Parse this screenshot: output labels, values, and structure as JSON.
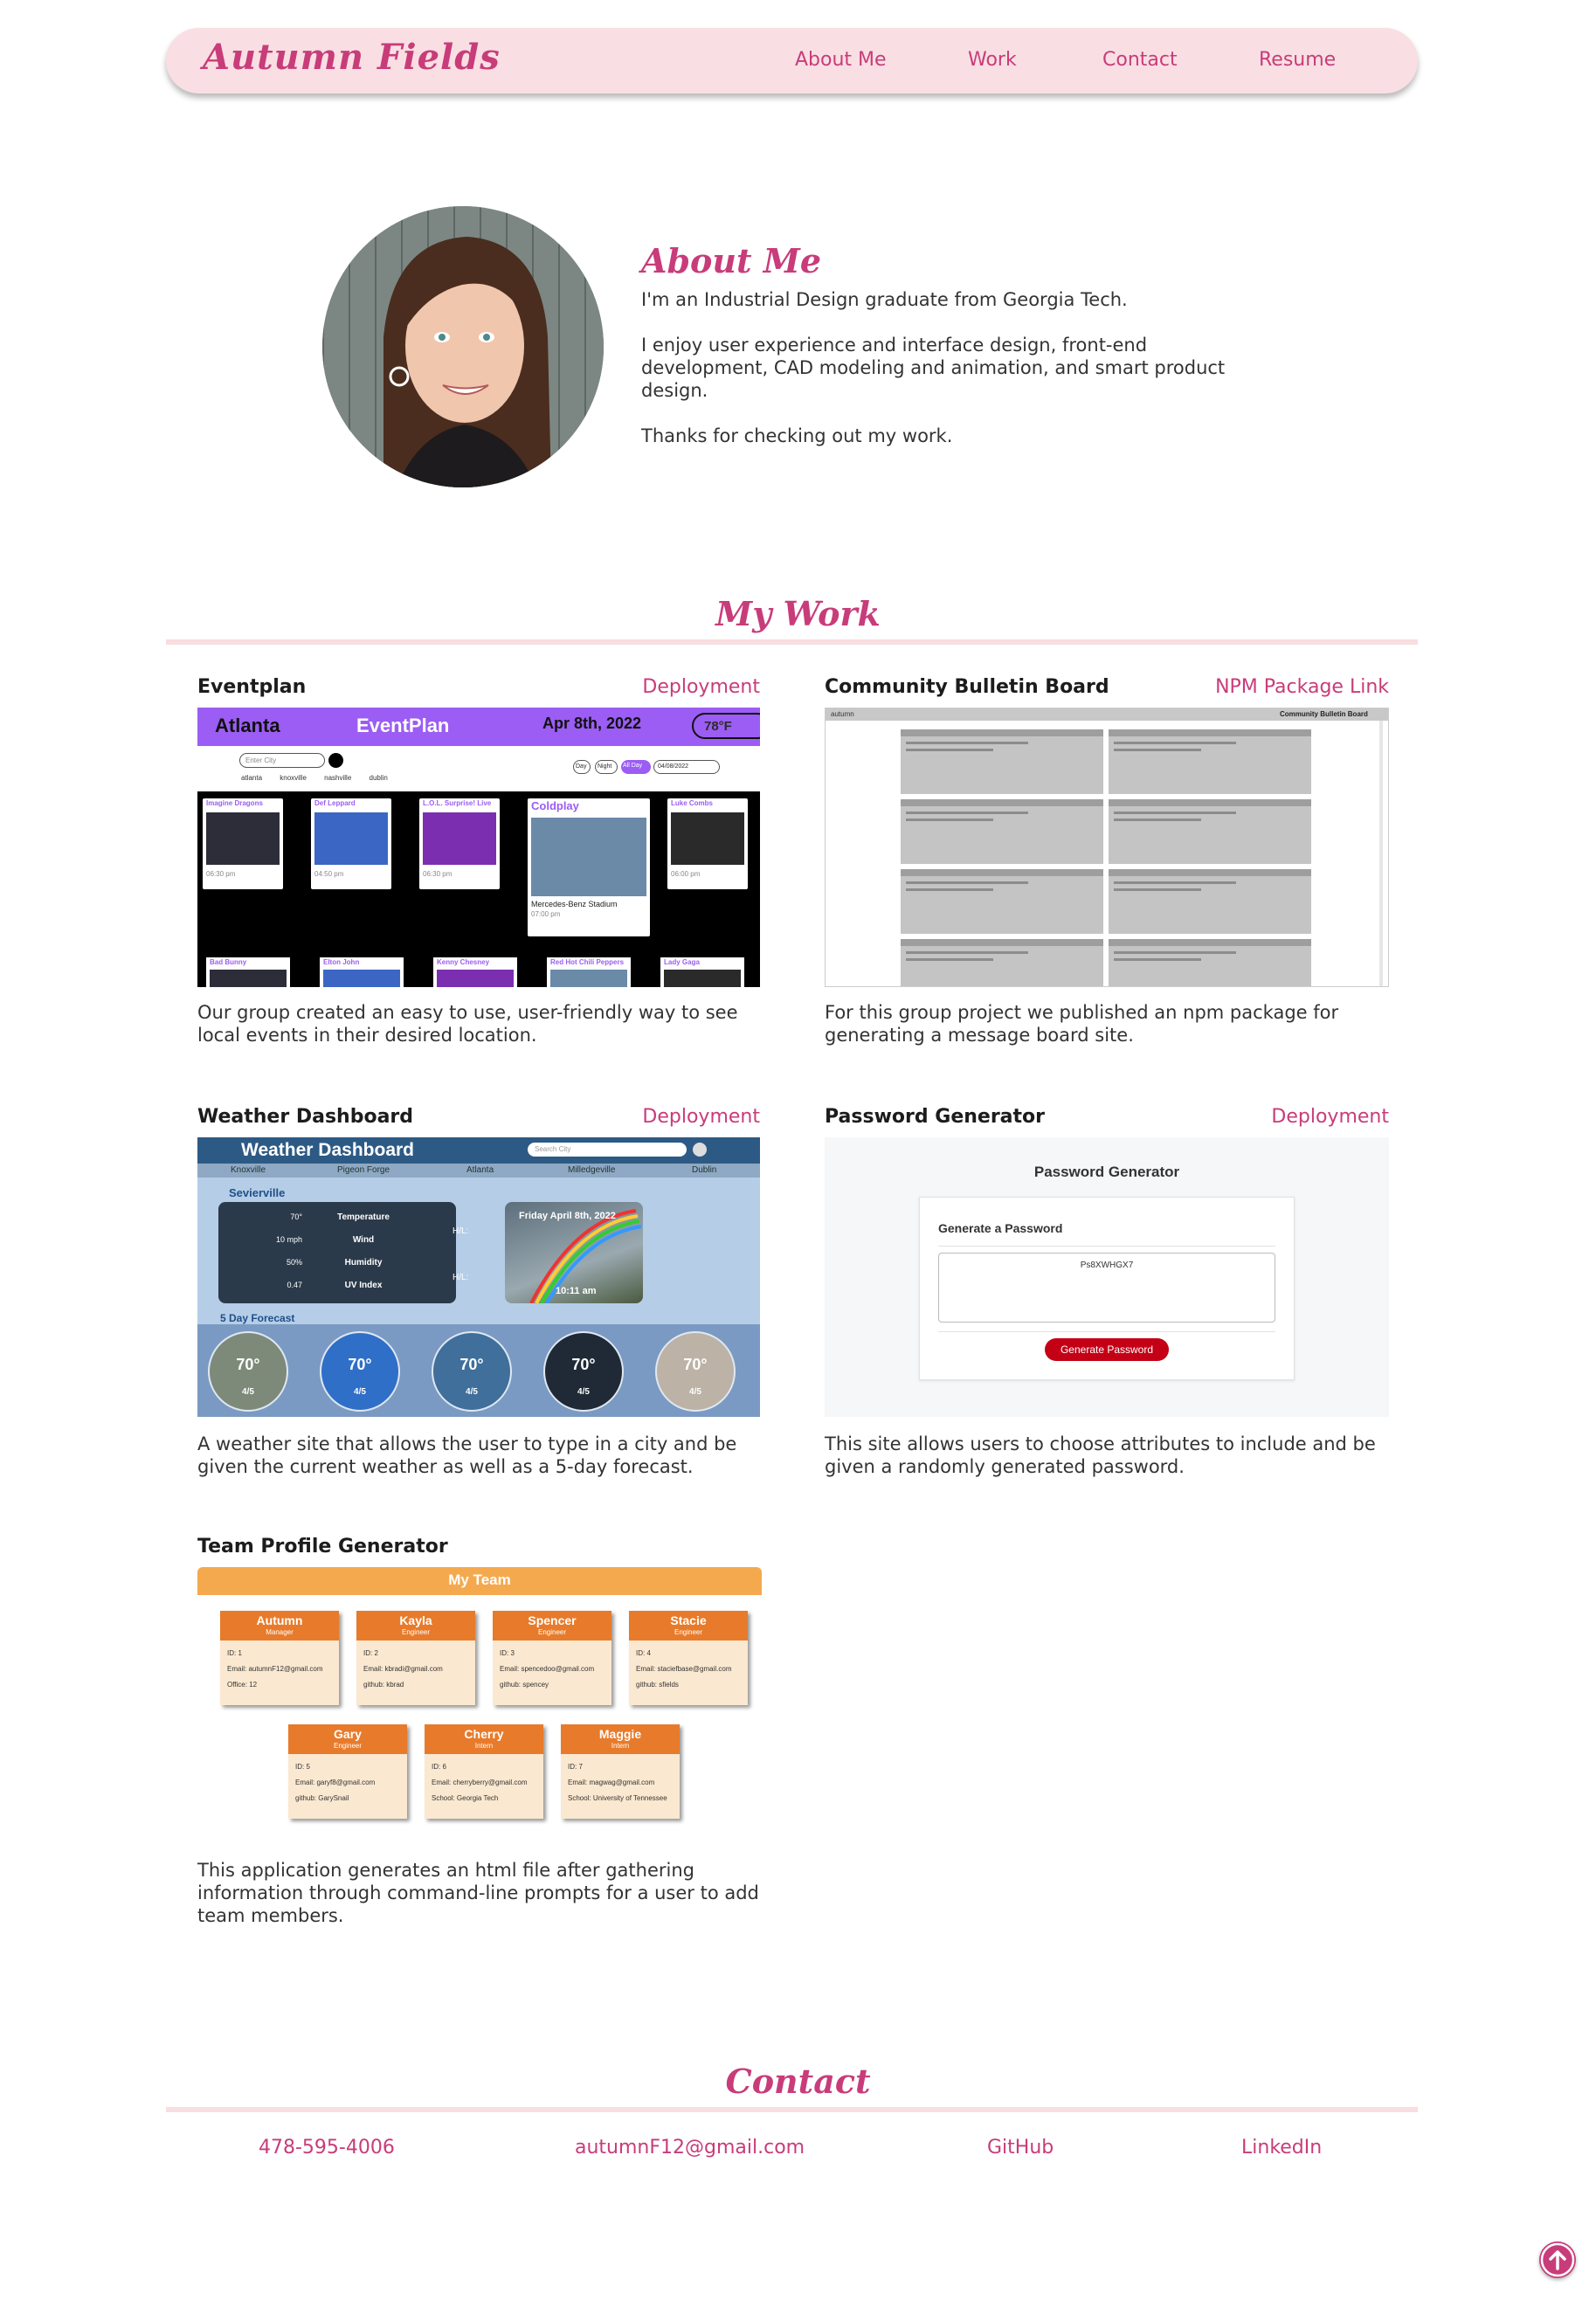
{
  "header": {
    "logo": "Autumn Fields",
    "nav": [
      "About Me",
      "Work",
      "Contact",
      "Resume"
    ]
  },
  "about": {
    "title": "About Me",
    "paragraphs": [
      "I'm an Industrial Design graduate from Georgia Tech.",
      "I enjoy user experience and interface design, front-end development, CAD modeling and animation, and smart product design.",
      "Thanks for checking out my work."
    ]
  },
  "work": {
    "title": "My Work",
    "projects": [
      {
        "title": "Eventplan",
        "link": "Deployment",
        "description": "Our group created an easy to use, user-friendly way to see local events in their desired location."
      },
      {
        "title": "Community Bulletin Board",
        "link": "NPM Package Link",
        "description": "For this group project we published an npm package for generating a message board site."
      },
      {
        "title": "Weather Dashboard",
        "link": "Deployment",
        "description": "A weather site that allows the user to type in a city and be given the current weather as well as a 5-day forecast."
      },
      {
        "title": "Password Generator",
        "link": "Deployment",
        "description": "This site allows users to choose attributes to include and be given a randomly generated password."
      },
      {
        "title": "Team Profile Generator",
        "link": "",
        "description": "This application generates an html file after gathering information through command-line prompts for a user to add team members."
      }
    ]
  },
  "eventplan_shot": {
    "city": "Atlanta",
    "app": "EventPlan",
    "date": "Apr 8th, 2022",
    "temp": "78°F",
    "search_placeholder": "Enter City",
    "cities": [
      "atlanta",
      "knoxville",
      "nashville",
      "dublin"
    ],
    "filters": [
      "Day",
      "Night",
      "All Day"
    ],
    "date_input": "04/08/2022",
    "events": [
      {
        "name": "Imagine Dragons",
        "time": "06:30 pm"
      },
      {
        "name": "Def Leppard",
        "time": "04:50 pm"
      },
      {
        "name": "L.O.L. Surprise! Live",
        "time": "06:30 pm"
      },
      {
        "name": "Coldplay",
        "time": "07:00 pm",
        "venue": "Mercedes-Benz Stadium"
      },
      {
        "name": "Luke Combs",
        "time": "06:00 pm"
      }
    ],
    "events_row2": [
      "Bad Bunny",
      "Elton John",
      "Kenny Chesney",
      "Red Hot Chili Peppers",
      "Lady Gaga"
    ]
  },
  "bulletin_shot": {
    "left_label": "autumn",
    "right_label": "Community Bulletin Board"
  },
  "weather_shot": {
    "title": "Weather Dashboard",
    "search_placeholder": "Search City",
    "cities": [
      "Knoxville",
      "Pigeon Forge",
      "Atlanta",
      "Milledgeville",
      "Dublin"
    ],
    "current_city": "Sevierville",
    "stats": [
      {
        "value": "70°",
        "label": "Temperature"
      },
      {
        "value": "10 mph",
        "label": "Wind"
      },
      {
        "value": "50%",
        "label": "Humidity"
      },
      {
        "value": "0.47",
        "label": "UV Index"
      }
    ],
    "hl_label": "H/L:",
    "day_label": "Friday April 8th, 2022",
    "clock": "10:11 am",
    "forecast_title": "5 Day Forecast",
    "forecast": [
      {
        "temp": "70°",
        "date": "4/5"
      },
      {
        "temp": "70°",
        "date": "4/5"
      },
      {
        "temp": "70°",
        "date": "4/5"
      },
      {
        "temp": "70°",
        "date": "4/5"
      },
      {
        "temp": "70°",
        "date": "4/5"
      }
    ]
  },
  "password_shot": {
    "title": "Password Generator",
    "card_title": "Generate a Password",
    "password": "Ps8XWHGX7",
    "button": "Generate Password"
  },
  "team_shot": {
    "title": "My Team",
    "members": [
      {
        "name": "Autumn",
        "role": "Manager",
        "id": "ID: 1",
        "email": "Email: autumnF12@gmail.com",
        "extra": "Office: 12"
      },
      {
        "name": "Kayla",
        "role": "Engineer",
        "id": "ID: 2",
        "email": "Email: kbradi@gmail.com",
        "extra": "github: kbrad"
      },
      {
        "name": "Spencer",
        "role": "Engineer",
        "id": "ID: 3",
        "email": "Email: spencedoo@gmail.com",
        "extra": "github: spencey"
      },
      {
        "name": "Stacie",
        "role": "Engineer",
        "id": "ID: 4",
        "email": "Email: staciefbase@gmail.com",
        "extra": "github: sfields"
      },
      {
        "name": "Gary",
        "role": "Engineer",
        "id": "ID: 5",
        "email": "Email: garyf8@gmail.com",
        "extra": "github: GarySnail"
      },
      {
        "name": "Cherry",
        "role": "Intern",
        "id": "ID: 6",
        "email": "Email: cherryberry@gmail.com",
        "extra": "School: Georgia Tech"
      },
      {
        "name": "Maggie",
        "role": "Intern",
        "id": "ID: 7",
        "email": "Email: magwag@gmail.com",
        "extra": "School: University of Tennessee"
      }
    ]
  },
  "contact": {
    "title": "Contact",
    "links": [
      "478-595-4006",
      "autumnF12@gmail.com",
      "GitHub",
      "LinkedIn"
    ]
  },
  "icons": {
    "back_to_top": "arrow-up-circle-icon"
  },
  "colors": {
    "brand_pink": "#c83c7a",
    "header_bg": "#f9dfe3",
    "rule": "#f8dde1"
  }
}
